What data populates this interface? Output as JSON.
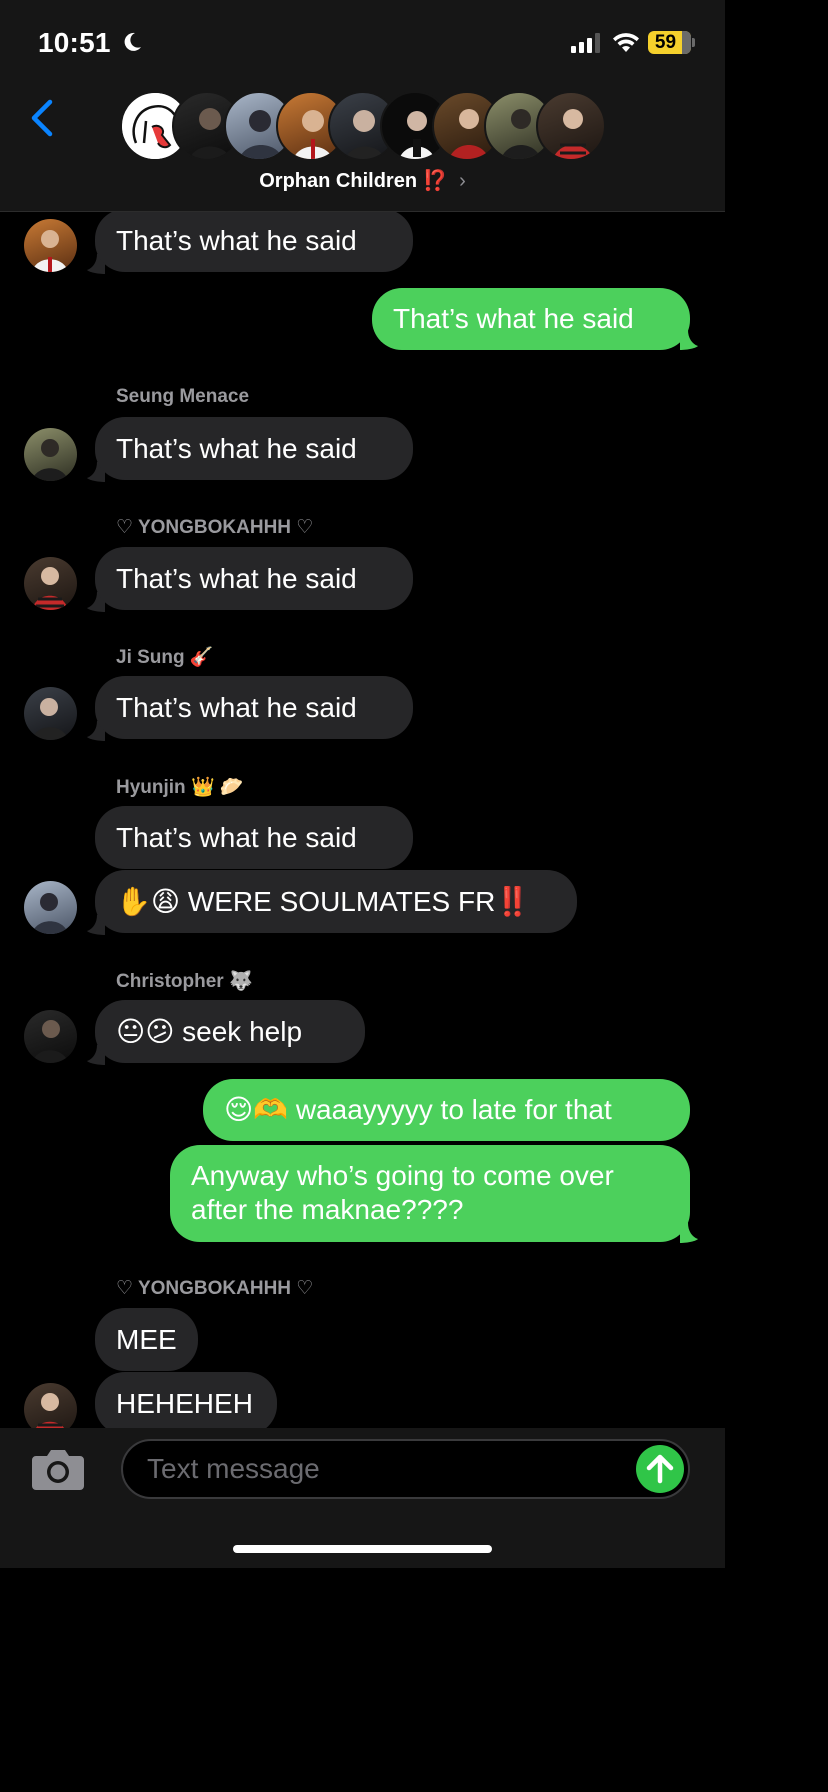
{
  "status_bar": {
    "time": "10:51",
    "battery": "59",
    "icons": [
      "moon-icon",
      "cellular-signal-icon",
      "wifi-icon",
      "battery-icon"
    ]
  },
  "header": {
    "group_name": "Orphan Children",
    "group_marks": "⁉️",
    "chevron": "›",
    "member_avatar_count": 10
  },
  "messages": [
    {
      "dir": "in",
      "text": "That’s what he said",
      "avatar": true
    },
    {
      "dir": "out",
      "text": "That’s what he said"
    },
    {
      "dir": "in",
      "sender": "Seung Menace",
      "text": "That’s what he said",
      "avatar": true
    },
    {
      "dir": "in",
      "sender": "♡ YONGBOKAHHH ♡",
      "text": "That’s what he said",
      "avatar": true
    },
    {
      "dir": "in",
      "sender": "Ji Sung 🎸",
      "text": "That’s what he said",
      "avatar": true
    },
    {
      "dir": "in",
      "sender": "Hyunjin 👑 🥟",
      "text": "That’s what he said",
      "avatar": false
    },
    {
      "dir": "in",
      "text": "✋😩 WERE SOULMATES FR‼️",
      "avatar": true
    },
    {
      "dir": "in",
      "sender": "Christopher 🐺",
      "text": "😐😕 seek help",
      "avatar": true
    },
    {
      "dir": "out",
      "text": "😌🫶 waaayyyyy to late for that"
    },
    {
      "dir": "out",
      "text": "Anyway who’s going to come over after the maknae????"
    },
    {
      "dir": "in",
      "sender": "♡ YONGBOKAHHH ♡",
      "text": "MEE",
      "avatar": false
    },
    {
      "dir": "in",
      "text": "HEHEHEH",
      "avatar": true
    }
  ],
  "input": {
    "placeholder": "Text message"
  },
  "colors": {
    "incoming_bubble": "#262628",
    "outgoing_bubble": "#4cd05c",
    "accent_blue": "#0a84ff",
    "send_green": "#30c548"
  }
}
